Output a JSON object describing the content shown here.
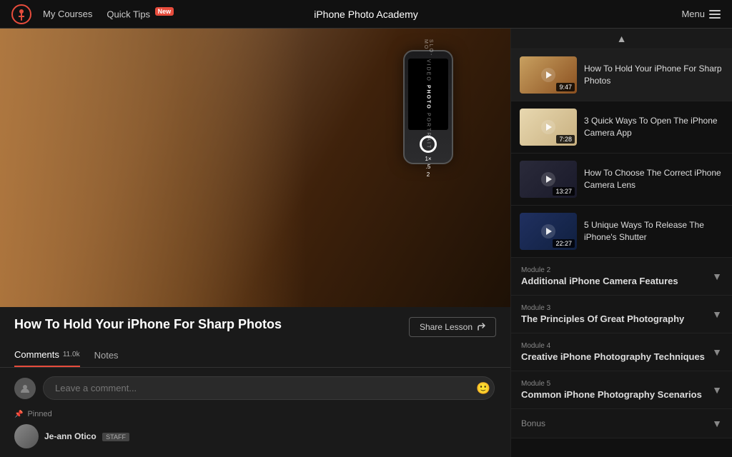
{
  "nav": {
    "logo_alt": "Teachable logo",
    "my_courses": "My Courses",
    "quick_tips": "Quick Tips",
    "badge_new": "New",
    "title": "iPhone Photo Academy",
    "menu_label": "Menu"
  },
  "video": {
    "title": "How To Hold Your iPhone For Sharp Photos",
    "share_label": "Share Lesson"
  },
  "tabs": [
    {
      "label": "Comments",
      "badge": "11.0k",
      "active": true
    },
    {
      "label": "Notes",
      "badge": "",
      "active": false
    }
  ],
  "comments": {
    "placeholder": "Leave a comment...",
    "pinned_label": "Pinned",
    "username": "Je-ann Otico",
    "staff_badge": "STAFF"
  },
  "sidebar": {
    "lessons": [
      {
        "title": "How To Hold Your iPhone For Sharp Photos",
        "duration": "9:47",
        "thumb_style": "thumb-warm",
        "active": true
      },
      {
        "title": "3 Quick Ways To Open The iPhone Camera App",
        "duration": "7:28",
        "thumb_style": "thumb-light",
        "active": false
      },
      {
        "title": "How To Choose The Correct iPhone Camera Lens",
        "duration": "13:27",
        "thumb_style": "thumb-dark",
        "active": false
      },
      {
        "title": "5 Unique Ways To Release The iPhone's Shutter",
        "duration": "22:27",
        "thumb_style": "thumb-blue",
        "active": false
      }
    ],
    "modules": [
      {
        "label": "Module 2",
        "title": "Additional iPhone Camera Features"
      },
      {
        "label": "Module 3",
        "title": "The Principles Of Great Photography"
      },
      {
        "label": "Module 4",
        "title": "Creative iPhone Photography Techniques"
      },
      {
        "label": "Module 5",
        "title": "Common iPhone Photography Scenarios"
      }
    ],
    "bonus_label": "Bonus"
  }
}
